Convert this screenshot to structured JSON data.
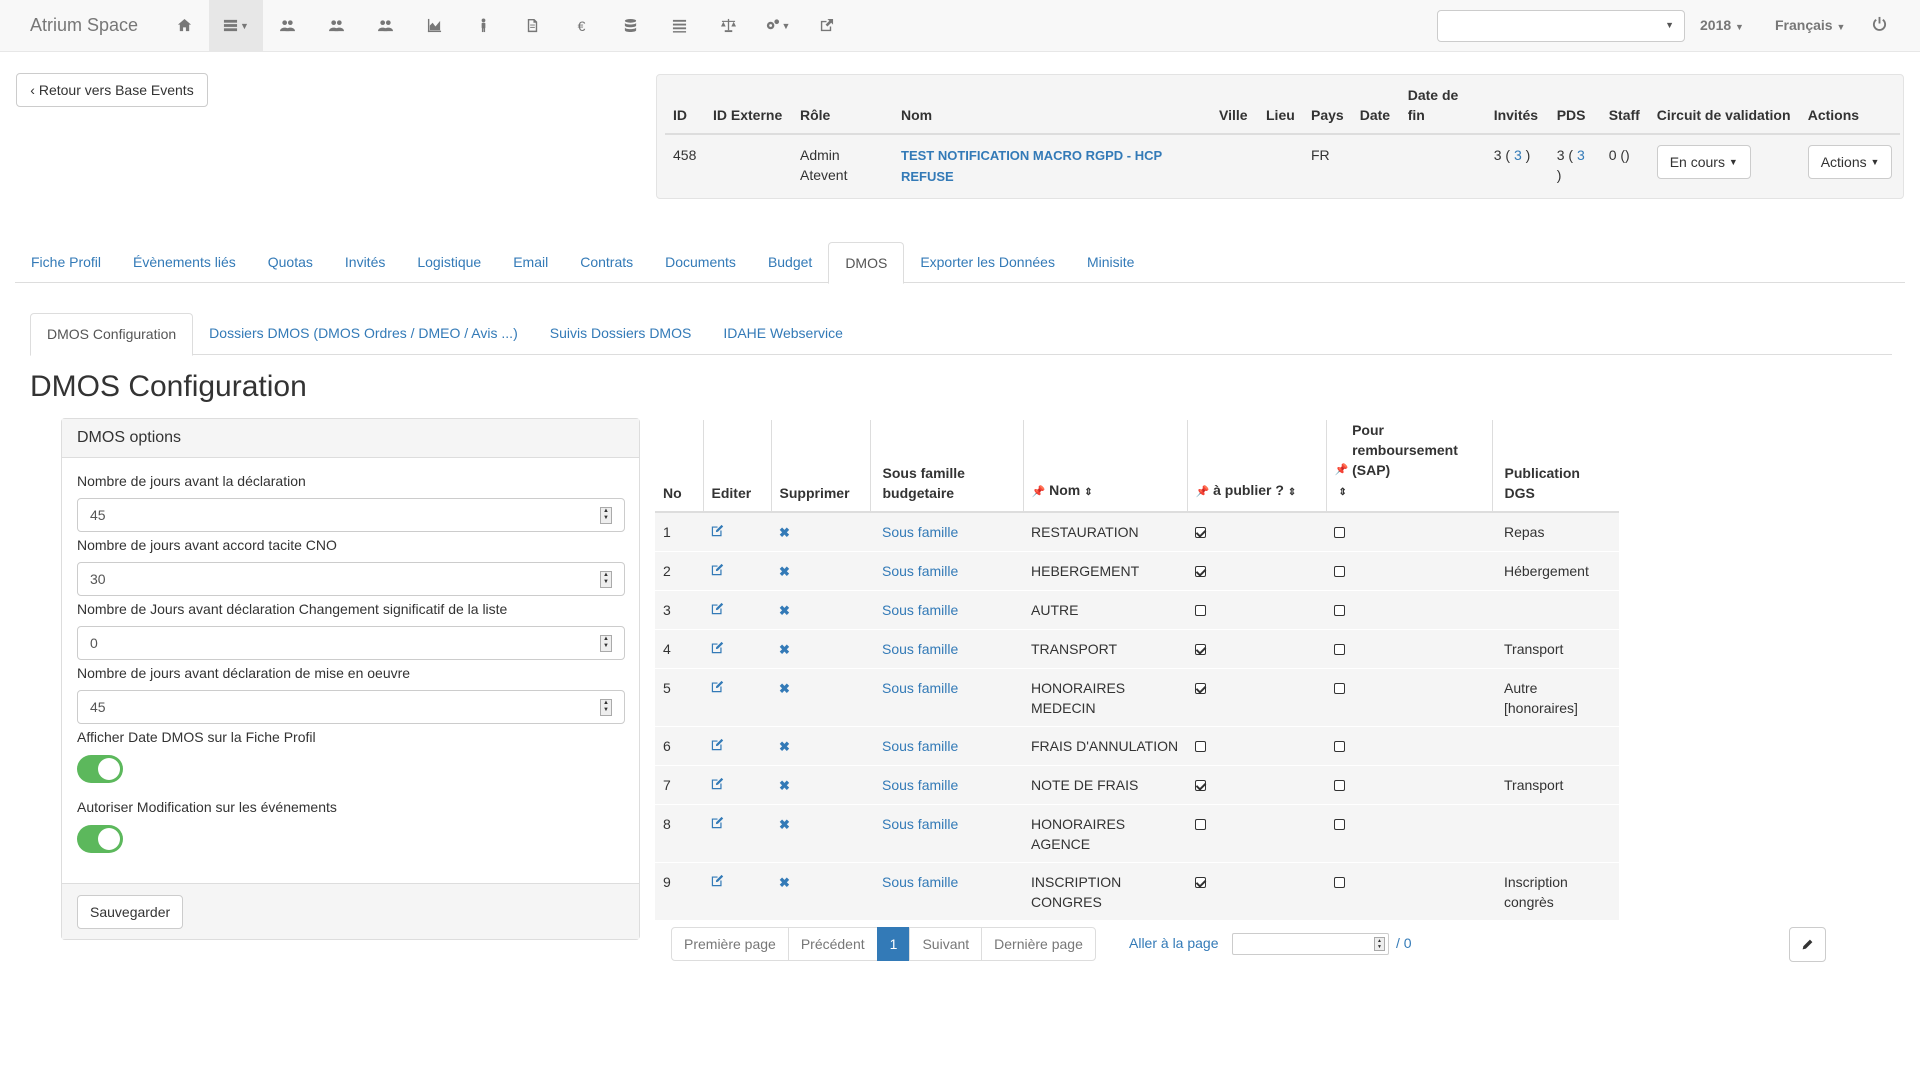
{
  "navbar": {
    "brand": "Atrium Space",
    "icons": [
      "home-icon",
      "list-dropdown-icon",
      "users-icon",
      "users-icon",
      "users-icon",
      "chart-icon",
      "person-icon",
      "document-icon",
      "euro-icon",
      "database-icon",
      "list-icon",
      "balance-icon",
      "cogs-dropdown-icon",
      "share-icon"
    ],
    "select_value": "",
    "year": "2018",
    "language": "Français"
  },
  "back_button": "‹ Retour vers Base Events",
  "event": {
    "headers": [
      "ID",
      "ID Externe",
      "Rôle",
      "Nom",
      "Ville",
      "Lieu",
      "Pays",
      "Date",
      "Date de fin",
      "Invités",
      "PDS",
      "Staff",
      "Circuit de validation",
      "Actions"
    ],
    "row": {
      "id": "458",
      "id_externe": "",
      "role": "Admin Atevent",
      "nom": "TEST NOTIFICATION MACRO RGPD - HCP REFUSE",
      "ville": "",
      "lieu": "",
      "pays": "FR",
      "date": "",
      "date_fin": "",
      "invites_pre": "3 (",
      "invites_link": "3",
      "invites_post": ")",
      "pds_pre": "3 (",
      "pds_link": "3",
      "pds_post": ")",
      "staff": "0 ()",
      "circuit_button": "En cours",
      "actions_button": "Actions"
    }
  },
  "tabs": [
    "Fiche Profil",
    "Évènements liés",
    "Quotas",
    "Invités",
    "Logistique",
    "Email",
    "Contrats",
    "Documents",
    "Budget",
    "DMOS",
    "Exporter les Données",
    "Minisite"
  ],
  "active_tab": "DMOS",
  "subtabs": [
    "DMOS Configuration",
    "Dossiers DMOS (DMOS Ordres / DMEO / Avis ...)",
    "Suivis Dossiers DMOS",
    "IDAHE Webservice"
  ],
  "page_title": "DMOS Configuration",
  "options": {
    "title": "DMOS options",
    "fields": [
      {
        "label": "Nombre de jours avant la déclaration",
        "value": "45"
      },
      {
        "label": "Nombre de jours avant accord tacite CNO",
        "value": "30"
      },
      {
        "label": "Nombre de Jours avant déclaration Changement significatif de la liste",
        "value": "0"
      },
      {
        "label": "Nombre de jours avant déclaration de mise en oeuvre",
        "value": "45"
      }
    ],
    "toggles": [
      {
        "label": "Afficher Date DMOS sur la Fiche Profil",
        "on": true
      },
      {
        "label": "Autoriser Modification sur les événements",
        "on": true
      }
    ],
    "save_button": "Sauvegarder"
  },
  "table": {
    "headers": {
      "no": "No",
      "editer": "Editer",
      "supprimer": "Supprimer",
      "sous_famille": "Sous famille budgetaire",
      "nom": "Nom",
      "publier": "à publier ?",
      "remboursement": "Pour remboursement (SAP)",
      "publication": "Publication DGS"
    },
    "rows": [
      {
        "no": "1",
        "sous_famille": "Sous famille",
        "nom": "RESTAURATION",
        "publier": true,
        "rembours": false,
        "publication": "Repas"
      },
      {
        "no": "2",
        "sous_famille": "Sous famille",
        "nom": "HEBERGEMENT",
        "publier": true,
        "rembours": false,
        "publication": "Hébergement"
      },
      {
        "no": "3",
        "sous_famille": "Sous famille",
        "nom": "AUTRE",
        "publier": false,
        "rembours": false,
        "publication": ""
      },
      {
        "no": "4",
        "sous_famille": "Sous famille",
        "nom": "TRANSPORT",
        "publier": true,
        "rembours": false,
        "publication": "Transport"
      },
      {
        "no": "5",
        "sous_famille": "Sous famille",
        "nom": "HONORAIRES MEDECIN",
        "publier": true,
        "rembours": false,
        "publication": "Autre [honoraires]"
      },
      {
        "no": "6",
        "sous_famille": "Sous famille",
        "nom": "FRAIS D'ANNULATION",
        "publier": false,
        "rembours": false,
        "publication": ""
      },
      {
        "no": "7",
        "sous_famille": "Sous famille",
        "nom": "NOTE DE FRAIS",
        "publier": true,
        "rembours": false,
        "publication": "Transport"
      },
      {
        "no": "8",
        "sous_famille": "Sous famille",
        "nom": "HONORAIRES AGENCE",
        "publier": false,
        "rembours": false,
        "publication": ""
      },
      {
        "no": "9",
        "sous_famille": "Sous famille",
        "nom": "INSCRIPTION CONGRES",
        "publier": true,
        "rembours": false,
        "publication": "Inscription congrès"
      }
    ]
  },
  "pagination": {
    "first": "Première page",
    "prev": "Précédent",
    "current": "1",
    "next": "Suivant",
    "last": "Dernière page",
    "goto_label": "Aller à la page",
    "goto_value": "",
    "total": "/ 0"
  }
}
